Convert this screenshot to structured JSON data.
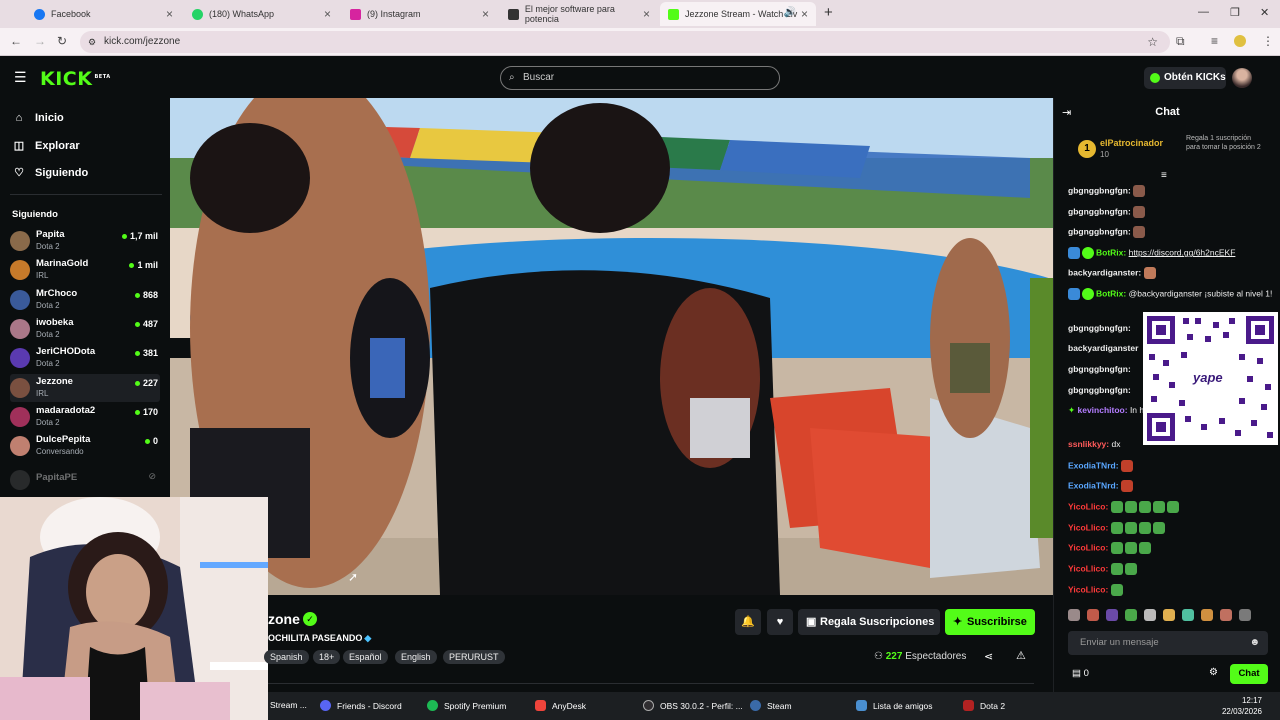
{
  "browser": {
    "tabs": [
      {
        "label": "Facebook",
        "color": "#1877f2"
      },
      {
        "label": "(180) WhatsApp",
        "color": "#25d366"
      },
      {
        "label": "(9) Instagram",
        "color": "#d6249f"
      },
      {
        "label": "El mejor software para potencia",
        "color": "#333333"
      },
      {
        "label": "Jezzone Stream - Watch Liv",
        "color": "#53fc18"
      }
    ],
    "url": "kick.com/jezzone"
  },
  "header": {
    "logo": "KICK",
    "logo_badge": "BETA",
    "search_placeholder": "Buscar",
    "get_kicks": "Obtén KICKs"
  },
  "sidebar": {
    "nav": [
      {
        "label": "Inicio",
        "icon": "home-icon"
      },
      {
        "label": "Explorar",
        "icon": "compass-icon"
      },
      {
        "label": "Siguiendo",
        "icon": "heart-icon"
      }
    ],
    "following_title": "Siguiendo",
    "following": [
      {
        "name": "Papita",
        "category": "Dota 2",
        "viewers": "1,7 mil",
        "color": "#8a6a4a"
      },
      {
        "name": "MarinaGold",
        "category": "IRL",
        "viewers": "1 mil",
        "color": "#c77a2a"
      },
      {
        "name": "MrChoco",
        "category": "Dota 2",
        "viewers": "868",
        "color": "#3a5a9a"
      },
      {
        "name": "iwobeka",
        "category": "Dota 2",
        "viewers": "487",
        "color": "#aa7788"
      },
      {
        "name": "JeriCHODota",
        "category": "Dota 2",
        "viewers": "381",
        "color": "#5a3ab0"
      },
      {
        "name": "Jezzone",
        "category": "IRL",
        "viewers": "227",
        "color": "#7a5040"
      },
      {
        "name": "madaradota2",
        "category": "Dota 2",
        "viewers": "170",
        "color": "#a0305a"
      },
      {
        "name": "DulcePepita",
        "category": "Conversando",
        "viewers": "0",
        "color": "#c08070"
      },
      {
        "name": "PapitaPE",
        "category": "",
        "viewers": "",
        "color": "#555555"
      }
    ]
  },
  "stream": {
    "name": "zone",
    "subtitle": "OCHILITA PASEANDO",
    "tags": [
      "Spanish",
      "18+",
      "Español",
      "English",
      "PERURUST"
    ],
    "gift_label": "Regala Suscripciones",
    "subscribe_label": "Suscribirse",
    "viewers_count": "227",
    "viewers_label": "Espectadores"
  },
  "chat": {
    "title": "Chat",
    "pinned": {
      "rank": "1",
      "user": "elPatrocinador",
      "count": "10",
      "note": "Regala 1 suscripción para tomar la posición 2"
    },
    "messages": [
      {
        "user": "gbgnggbngfgn:",
        "text": "",
        "color": "#ffffff"
      },
      {
        "user": "gbgnggbngfgn:",
        "text": "",
        "color": "#ffffff"
      },
      {
        "user": "gbgnggbngfgn:",
        "text": "",
        "color": "#ffffff"
      },
      {
        "user": "BotRix:",
        "text": "https://discord.gg/6h2ncEKF",
        "color": "#53fc18"
      },
      {
        "user": "backyardiganster:",
        "text": "",
        "color": "#ffffff"
      },
      {
        "user": "BotRix:",
        "text": "@backyardiganster ¡subiste al nivel 1!",
        "color": "#53fc18"
      },
      {
        "user": "gbgnggbngfgn:",
        "text": "",
        "color": "#ffffff"
      },
      {
        "user": "backyardiganster",
        "text": "",
        "color": "#ffffff"
      },
      {
        "user": "gbgnggbngfgn:",
        "text": "",
        "color": "#ffffff"
      },
      {
        "user": "gbgnggbngfgn:",
        "text": "",
        "color": "#ffffff"
      },
      {
        "user": "kevinchitoo:",
        "text": "In hambre come nom",
        "color": "#b37dff"
      },
      {
        "user": "ssnlikkyy:",
        "text": "dx",
        "color": "#ff5a5a"
      },
      {
        "user": "ExodiaTNrd:",
        "text": "",
        "color": "#5aa7ff"
      },
      {
        "user": "ExodiaTNrd:",
        "text": "",
        "color": "#5aa7ff"
      },
      {
        "user": "YicoLlico:",
        "text": "",
        "color": "#ff3a3a"
      },
      {
        "user": "YicoLlico:",
        "text": "",
        "color": "#ff3a3a"
      },
      {
        "user": "YicoLlico:",
        "text": "",
        "color": "#ff3a3a"
      },
      {
        "user": "YicoLlico:",
        "text": "",
        "color": "#ff3a3a"
      },
      {
        "user": "YicoLlico:",
        "text": "",
        "color": "#ff3a3a"
      }
    ],
    "qr_brand": "yape",
    "input_placeholder": "Enviar un mensaje",
    "kicks_balance": "0",
    "send_label": "Chat"
  },
  "taskbar": {
    "apps": [
      {
        "label": "Stream ...",
        "color": "#53fc18"
      },
      {
        "label": "Friends - Discord",
        "color": "#5865f2"
      },
      {
        "label": "Spotify Premium",
        "color": "#1db954"
      },
      {
        "label": "AnyDesk",
        "color": "#ef443b"
      },
      {
        "label": "OBS 30.0.2 - Perfil: ...",
        "color": "#302e31"
      },
      {
        "label": "Steam",
        "color": "#1b2838"
      },
      {
        "label": "Lista de amigos",
        "color": "#4a8fd0"
      },
      {
        "label": "Dota 2",
        "color": "#b22222"
      }
    ],
    "time": "12:17",
    "date": "22/03/2026"
  }
}
